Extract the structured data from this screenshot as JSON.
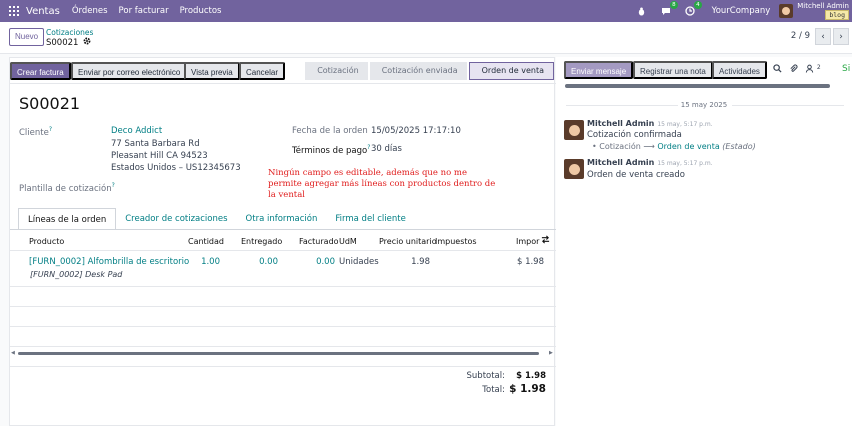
{
  "navbar": {
    "app_name": "Ventas",
    "menus": [
      "Órdenes",
      "Por facturar",
      "Productos"
    ],
    "messages_count": "8",
    "activities_count": "4",
    "company": "YourCompany",
    "user": "Mitchell Admin",
    "database": "blog"
  },
  "control": {
    "new_label": "Nuevo",
    "breadcrumb": "Cotizaciones",
    "record_name": "S00021",
    "pager": "2 / 9"
  },
  "statusbar": {
    "buttons": [
      "Crear factura",
      "Enviar por correo electrónico",
      "Vista previa",
      "Cancelar"
    ],
    "stages": [
      "Cotización",
      "Cotización enviada",
      "Orden de venta"
    ]
  },
  "form": {
    "title": "S00021",
    "customer_label": "Cliente",
    "customer_name": "Deco Addict",
    "customer_address": [
      "77 Santa Barbara Rd",
      "Pleasant Hill CA 94523",
      "Estados Unidos – US12345673"
    ],
    "template_label": "Plantilla de cotización",
    "order_date_label": "Fecha de la orden",
    "order_date": "15/05/2025 17:17:10",
    "payment_terms_label": "Términos de pago",
    "payment_terms": "30 días",
    "annotation": "Ningún campo es editable, además que no me permite agregar más líneas con productos dentro de la vental"
  },
  "tabs": [
    "Líneas de la orden",
    "Creador de cotizaciones",
    "Otra información",
    "Firma del cliente"
  ],
  "lines": {
    "headers": [
      "Producto",
      "Cantidad",
      "Entregado",
      "Facturado",
      "UdM",
      "Precio unitario",
      "Impuestos",
      "Impor"
    ],
    "rows": [
      {
        "product": "[FURN_0002] Alfombrilla de escritorio",
        "description": "[FURN_0002] Desk Pad",
        "quantity": "1.00",
        "delivered": "0.00",
        "invoiced": "0.00",
        "uom": "Unidades",
        "unit_price": "1.98",
        "taxes": "",
        "amount": "$ 1.98"
      }
    ]
  },
  "totals": {
    "subtotal_label": "Subtotal:",
    "subtotal": "$ 1.98",
    "total_label": "Total:",
    "total": "$ 1.98"
  },
  "chatter": {
    "send_message": "Enviar mensaje",
    "log_note": "Registrar una nota",
    "activities": "Actividades",
    "followers_count": "2",
    "follow_label": "Si",
    "date_separator": "15 may 2025",
    "messages": [
      {
        "author": "Mitchell Admin",
        "time": "15 may, 5:17 p.m.",
        "body": "Cotización confirmada",
        "track_old": "Cotización",
        "track_new": "Orden de venta",
        "track_field": "(Estado)"
      },
      {
        "author": "Mitchell Admin",
        "time": "15 may, 5:17 p.m.",
        "body": "Orden de venta creado"
      }
    ]
  }
}
